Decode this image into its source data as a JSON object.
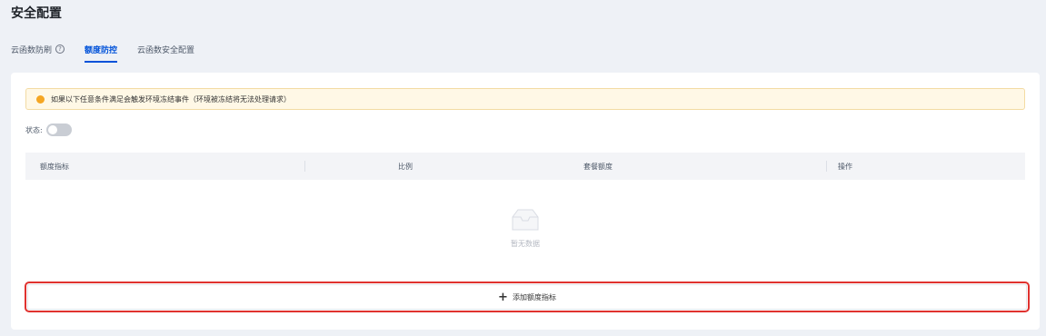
{
  "page": {
    "title": "安全配置"
  },
  "tabs": [
    {
      "label": "云函数防刷",
      "has_help": true,
      "active": false
    },
    {
      "label": "额度防控",
      "active": true
    },
    {
      "label": "云函数安全配置",
      "active": false
    }
  ],
  "alert": {
    "text": "如果以下任意条件满足会触发环境冻结事件（环境被冻结将无法处理请求）",
    "icon": "warning-dot-icon",
    "color": "#f5a623"
  },
  "status": {
    "label": "状态:",
    "enabled": false
  },
  "table": {
    "columns": [
      "额度指标",
      "比例",
      "套餐额度",
      "操作"
    ],
    "empty_text": "暂无数据",
    "empty_icon": "empty-box-icon"
  },
  "add_button": {
    "label": "添加额度指标",
    "icon": "plus-icon"
  },
  "colors": {
    "accent": "#0052d9",
    "highlight": "#e0322f"
  }
}
